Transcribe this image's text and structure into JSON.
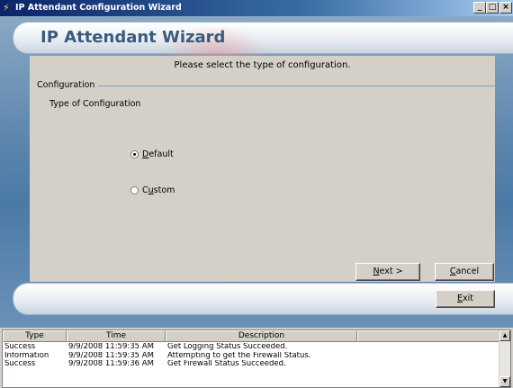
{
  "window": {
    "title": "IP Attendant Configuration Wizard",
    "min": "_",
    "max": "□",
    "close": "×"
  },
  "wizard": {
    "header_title": "IP Attendant Wizard",
    "prompt": "Please select the type of configuration.",
    "group_label": "Configuration",
    "type_label": "Type of Configuration",
    "options": [
      {
        "pre": "",
        "mnemonic": "D",
        "post": "efault",
        "selected": true
      },
      {
        "pre": "C",
        "mnemonic": "u",
        "post": "stom",
        "selected": false
      }
    ],
    "next_button": {
      "mnemonic": "N",
      "rest": "ext >"
    },
    "cancel_button": {
      "mnemonic": "C",
      "rest": "ancel"
    },
    "exit_button": {
      "mnemonic": "E",
      "rest": "xit"
    }
  },
  "log": {
    "columns": [
      "Type",
      "Time",
      "Description",
      ""
    ],
    "rows": [
      {
        "type": "Success",
        "time": "9/9/2008 11:59:35 AM",
        "description": "Get Logging Status Succeeded."
      },
      {
        "type": "Information",
        "time": "9/9/2008 11:59:35 AM",
        "description": "Attempting to get the Firewall Status."
      },
      {
        "type": "Success",
        "time": "9/9/2008 11:59:36 AM",
        "description": "Get Firewall Status Succeeded."
      }
    ]
  }
}
